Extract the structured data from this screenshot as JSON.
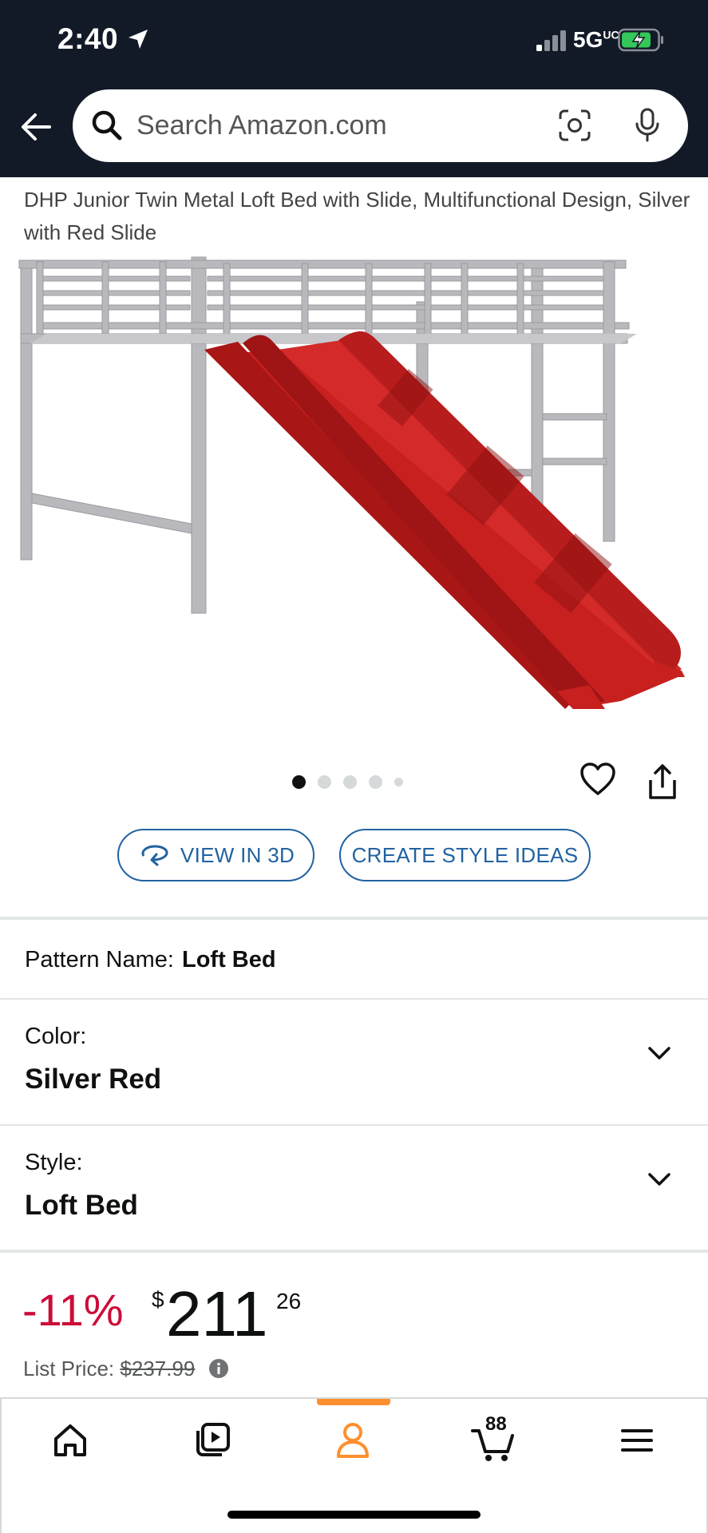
{
  "status_bar": {
    "time": "2:40",
    "network": "5G",
    "network_suffix": "UC"
  },
  "search": {
    "placeholder": "Search Amazon.com"
  },
  "product": {
    "title": "DHP Junior Twin Metal Loft Bed with Slide, Multifunctional Design, Silver with Red Slide",
    "carousel": {
      "total": 5,
      "active_index": 0
    }
  },
  "actions": {
    "view_3d": "VIEW IN 3D",
    "style_ideas": "CREATE STYLE IDEAS"
  },
  "pattern": {
    "label": "Pattern Name:",
    "value": "Loft Bed"
  },
  "color_option": {
    "label": "Color:",
    "value": "Silver Red"
  },
  "style_option": {
    "label": "Style:",
    "value": "Loft Bed"
  },
  "price": {
    "discount": "-11%",
    "currency": "$",
    "whole": "211",
    "fraction": "26",
    "list_label": "List Price:",
    "list_value": "$237.99"
  },
  "nav": {
    "cart_count": "88",
    "active": "account"
  },
  "colors": {
    "header_bg": "#131a27",
    "link_blue": "#2162a1",
    "discount_red": "#cc0c39",
    "nav_accent": "#ff8f2e",
    "slide_red": "#d42a2a"
  }
}
